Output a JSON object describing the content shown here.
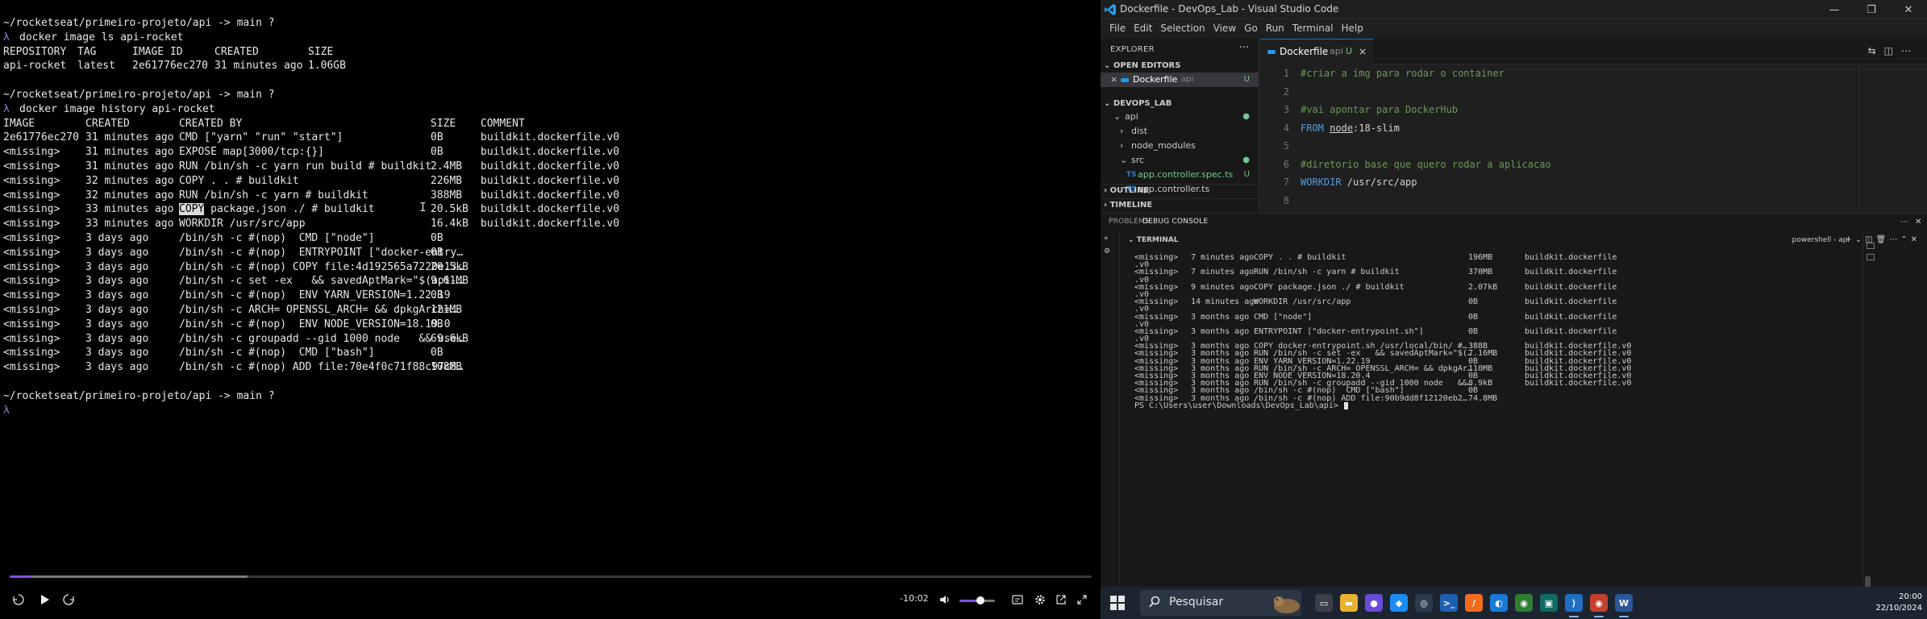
{
  "player": {
    "terminal_lines": [
      {
        "parts": [
          "~/rocketseat/primeiro-projeto/api -> main ?"
        ],
        "type": "prompt"
      },
      {
        "parts": [
          "λ",
          "docker image ls api-rocket"
        ],
        "type": "cmd"
      },
      {
        "cols": [
          "REPOSITORY",
          "TAG",
          "IMAGE ID",
          "CREATED",
          "SIZE"
        ],
        "type": "ls"
      },
      {
        "cols": [
          "api-rocket",
          "latest",
          "2e61776ec270",
          "31 minutes ago",
          "1.06GB"
        ],
        "type": "ls"
      },
      {
        "parts": [
          ""
        ],
        "type": "blank"
      },
      {
        "parts": [
          "~/rocketseat/primeiro-projeto/api -> main ?"
        ],
        "type": "prompt"
      },
      {
        "parts": [
          "λ",
          "docker image history api-rocket"
        ],
        "type": "cmd"
      },
      {
        "cols": [
          "IMAGE",
          "CREATED",
          "CREATED BY",
          "SIZE",
          "COMMENT"
        ],
        "type": "hist"
      },
      {
        "cols": [
          "2e61776ec270",
          "31 minutes ago",
          "CMD [\"yarn\" \"run\" \"start\"]",
          "0B",
          "buildkit.dockerfile.v0"
        ],
        "type": "hist"
      },
      {
        "cols": [
          "<missing>",
          "31 minutes ago",
          "EXPOSE map[3000/tcp:{}]",
          "0B",
          "buildkit.dockerfile.v0"
        ],
        "type": "hist"
      },
      {
        "cols": [
          "<missing>",
          "31 minutes ago",
          "RUN /bin/sh -c yarn run build # buildkit",
          "2.4MB",
          "buildkit.dockerfile.v0"
        ],
        "type": "hist"
      },
      {
        "cols": [
          "<missing>",
          "32 minutes ago",
          "COPY . . # buildkit",
          "226MB",
          "buildkit.dockerfile.v0"
        ],
        "type": "hist"
      },
      {
        "cols": [
          "<missing>",
          "32 minutes ago",
          "RUN /bin/sh -c yarn # buildkit",
          "388MB",
          "buildkit.dockerfile.v0"
        ],
        "type": "hist"
      },
      {
        "cols": [
          "<missing>",
          "33 minutes ago",
          "COPY| package.json ./ # buildkit",
          "20.5kB",
          "buildkit.dockerfile.v0"
        ],
        "type": "hist-sel"
      },
      {
        "cols": [
          "<missing>",
          "33 minutes ago",
          "WORKDIR /usr/src/app",
          "16.4kB",
          "buildkit.dockerfile.v0"
        ],
        "type": "hist"
      },
      {
        "cols": [
          "<missing>",
          "3 days ago",
          "/bin/sh -c #(nop)  CMD [\"node\"]",
          "0B",
          ""
        ],
        "type": "hist"
      },
      {
        "cols": [
          "<missing>",
          "3 days ago",
          "/bin/sh -c #(nop)  ENTRYPOINT [\"docker-entry…",
          "0B",
          ""
        ],
        "type": "hist"
      },
      {
        "cols": [
          "<missing>",
          "3 days ago",
          "/bin/sh -c #(nop) COPY file:4d192565a7220e13…",
          "20.5kB",
          ""
        ],
        "type": "hist"
      },
      {
        "cols": [
          "<missing>",
          "3 days ago",
          "/bin/sh -c set -ex   && savedAptMark=\"$(apt-…",
          "9.61MB",
          ""
        ],
        "type": "hist"
      },
      {
        "cols": [
          "<missing>",
          "3 days ago",
          "/bin/sh -c #(nop)  ENV YARN_VERSION=1.22.19",
          "0B",
          ""
        ],
        "type": "hist"
      },
      {
        "cols": [
          "<missing>",
          "3 days ago",
          "/bin/sh -c ARCH= OPENSSL_ARCH= && dpkgArch=…",
          "121MB",
          ""
        ],
        "type": "hist"
      },
      {
        "cols": [
          "<missing>",
          "3 days ago",
          "/bin/sh -c #(nop)  ENV NODE_VERSION=18.19.0",
          "0B",
          ""
        ],
        "type": "hist"
      },
      {
        "cols": [
          "<missing>",
          "3 days ago",
          "/bin/sh -c groupadd --gid 1000 node   && use…",
          "69.6kB",
          ""
        ],
        "type": "hist"
      },
      {
        "cols": [
          "<missing>",
          "3 days ago",
          "/bin/sh -c #(nop)  CMD [\"bash\"]",
          "0B",
          ""
        ],
        "type": "hist"
      },
      {
        "cols": [
          "<missing>",
          "3 days ago",
          "/bin/sh -c #(nop) ADD file:70e4f0c71f88c97c8…",
          "108MB",
          ""
        ],
        "type": "hist"
      },
      {
        "parts": [
          ""
        ],
        "type": "blank"
      },
      {
        "parts": [
          "~/rocketseat/primeiro-projeto/api -> main ?"
        ],
        "type": "prompt"
      },
      {
        "parts": [
          "λ"
        ],
        "type": "caret"
      }
    ],
    "time_remaining": "-10:02",
    "progress_fraction": 0.02,
    "buffered_fraction": 0.22,
    "volume_fraction": 0.6,
    "colors": {
      "accent": "#8a4de6"
    }
  },
  "vscode": {
    "title": "Dockerfile - DevOps_Lab - Visual Studio Code",
    "menu": [
      "File",
      "Edit",
      "Selection",
      "View",
      "Go",
      "Run",
      "Terminal",
      "Help"
    ],
    "explorer": {
      "header": "EXPLORER",
      "open_editors": "OPEN EDITORS",
      "open_file": {
        "close": "×",
        "name": "Dockerfile",
        "desc": "api",
        "status": "U"
      },
      "workspace": "DEVOPS_LAB",
      "tree": [
        {
          "name": "api",
          "badge": "●",
          "kind": "folder-open",
          "depth": 1
        },
        {
          "name": "dist",
          "badge": "",
          "kind": "folder",
          "depth": 2
        },
        {
          "name": "node_modules",
          "badge": "",
          "kind": "folder",
          "depth": 2
        },
        {
          "name": "src",
          "badge": "●",
          "kind": "folder-open",
          "depth": 2
        },
        {
          "name": "app.controller.spec.ts",
          "badge": "U",
          "kind": "ts",
          "depth": 3
        },
        {
          "name": "app.controller.ts",
          "badge": "",
          "kind": "ts",
          "depth": 3
        }
      ],
      "outline": "OUTLINE",
      "timeline": "TIMELINE"
    },
    "tab": {
      "name": "Dockerfile",
      "desc": "api",
      "status": "U",
      "close": "×"
    },
    "code": [
      {
        "n": "1",
        "tokens": [
          {
            "c": "cmt",
            "t": "#criar a img para rodar o container"
          }
        ]
      },
      {
        "n": "2",
        "tokens": []
      },
      {
        "n": "3",
        "tokens": [
          {
            "c": "cmt",
            "t": "#vai apontar para DockerHub"
          }
        ]
      },
      {
        "n": "4",
        "tokens": [
          {
            "c": "kw",
            "t": "FROM"
          },
          {
            "c": "tx",
            "t": " "
          },
          {
            "c": "tx",
            "t": "node"
          },
          {
            "c": "tx",
            "t": ":18-slim"
          }
        ]
      },
      {
        "n": "5",
        "tokens": []
      },
      {
        "n": "6",
        "tokens": [
          {
            "c": "cmt",
            "t": "#diretorio base que quero rodar a aplicacao"
          }
        ]
      },
      {
        "n": "7",
        "tokens": [
          {
            "c": "kw",
            "t": "WORKDIR"
          },
          {
            "c": "tx",
            "t": " /usr/src/app"
          }
        ]
      },
      {
        "n": "8",
        "tokens": []
      }
    ],
    "panel_tabs": [
      "PROBLEMS",
      "DEBUG CONSOLE"
    ],
    "terminal_title": "TERMINAL",
    "terminal_shell": "powershell - api",
    "terminal_lines": [
      {
        "cols": [
          "<missing>",
          "7 minutes ago",
          "COPY . . # buildkit",
          "196MB",
          "buildkit.dockerfile"
        ]
      },
      {
        "cols": [
          ".v0",
          "",
          "",
          "",
          ""
        ]
      },
      {
        "cols": [
          "<missing>",
          "7 minutes ago",
          "RUN /bin/sh -c yarn # buildkit",
          "370MB",
          "buildkit.dockerfile"
        ]
      },
      {
        "cols": [
          ".v0",
          "",
          "",
          "",
          ""
        ]
      },
      {
        "cols": [
          "<missing>",
          "9 minutes ago",
          "COPY package.json ./ # buildkit",
          "2.07kB",
          "buildkit.dockerfile"
        ]
      },
      {
        "cols": [
          ".v0",
          "",
          "",
          "",
          ""
        ]
      },
      {
        "cols": [
          "<missing>",
          "14 minutes ago",
          "WORKDIR /usr/src/app",
          "0B",
          "buildkit.dockerfile"
        ]
      },
      {
        "cols": [
          ".v0",
          "",
          "",
          "",
          ""
        ]
      },
      {
        "cols": [
          "<missing>",
          "3 months ago",
          "CMD [\"node\"]",
          "0B",
          "buildkit.dockerfile"
        ]
      },
      {
        "cols": [
          ".v0",
          "",
          "",
          "",
          ""
        ]
      },
      {
        "cols": [
          "<missing>",
          "3 months ago",
          "ENTRYPOINT [\"docker-entrypoint.sh\"]",
          "0B",
          "buildkit.dockerfile"
        ]
      },
      {
        "cols": [
          ".v0",
          "",
          "",
          "",
          ""
        ]
      },
      {
        "cols": [
          "<missing>",
          "3 months ago",
          "COPY docker-entrypoint.sh /usr/local/bin/ #…",
          "388B",
          "buildkit.dockerfile.v0"
        ]
      },
      {
        "cols": [
          "<missing>",
          "3 months ago",
          "RUN /bin/sh -c set -ex   && savedAptMark=\"$(…",
          "7.16MB",
          "buildkit.dockerfile.v0"
        ]
      },
      {
        "cols": [
          "<missing>",
          "3 months ago",
          "ENV YARN_VERSION=1.22.19",
          "0B",
          "buildkit.dockerfile.v0"
        ]
      },
      {
        "cols": [
          "<missing>",
          "3 months ago",
          "RUN /bin/sh -c ARCH= OPENSSL_ARCH= && dpkgAr…",
          "110MB",
          "buildkit.dockerfile.v0"
        ]
      },
      {
        "cols": [
          "<missing>",
          "3 months ago",
          "ENV NODE_VERSION=18.20.4",
          "0B",
          "buildkit.dockerfile.v0"
        ]
      },
      {
        "cols": [
          "<missing>",
          "3 months ago",
          "RUN /bin/sh -c groupadd --gid 1000 node   &&…",
          "8.9kB",
          "buildkit.dockerfile.v0"
        ]
      },
      {
        "cols": [
          "<missing>",
          "3 months ago",
          "/bin/sh -c #(nop)  CMD [\"bash\"]",
          "0B",
          ""
        ]
      },
      {
        "cols": [
          "<missing>",
          "3 months ago",
          "/bin/sh -c #(nop) ADD file:90b9dd8f12120eb2…",
          "74.8MB",
          ""
        ]
      }
    ],
    "ps_prompt": "PS C:\\Users\\user\\Downloads\\DevOps_Lab\\api> "
  },
  "taskbar": {
    "search_placeholder": "Pesquisar",
    "time": "20:00",
    "date": "22/10/2024",
    "apps": [
      {
        "name": "task-view",
        "color": "#3a3f4a",
        "glyph": "▭"
      },
      {
        "name": "file-explorer",
        "color": "#e8b22f",
        "glyph": "▬"
      },
      {
        "name": "app-blue-circle",
        "color": "#6a4bd8",
        "glyph": "●"
      },
      {
        "name": "app-blue-bird",
        "color": "#1d8cf0",
        "glyph": "◆"
      },
      {
        "name": "app-steam",
        "color": "#2a3a4f",
        "glyph": "◎"
      },
      {
        "name": "app-terminal-blue",
        "color": "#1e5fb3",
        "glyph": ">_"
      },
      {
        "name": "app-orange",
        "color": "#f26b1d",
        "glyph": "/"
      },
      {
        "name": "app-edge-blue",
        "color": "#1b7ad6",
        "glyph": "◐"
      },
      {
        "name": "chrome",
        "color": "#2e7d32",
        "glyph": "◉"
      },
      {
        "name": "app-teal",
        "color": "#0f6b63",
        "glyph": "▣"
      },
      {
        "name": "vscode",
        "color": "#1f6fc5",
        "glyph": "⟩"
      },
      {
        "name": "chrome-2",
        "color": "#c2402c",
        "glyph": "◉"
      },
      {
        "name": "word",
        "color": "#2b579a",
        "glyph": "W"
      }
    ]
  }
}
